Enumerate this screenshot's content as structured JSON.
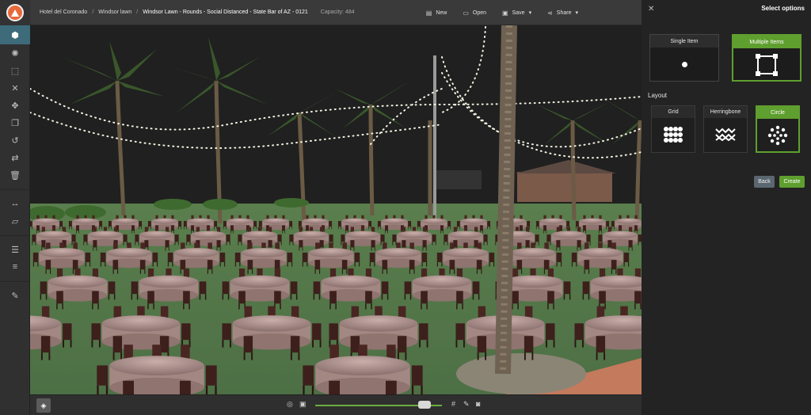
{
  "breadcrumb": {
    "venue": "Hotel del Coronado",
    "space": "Windsor lawn",
    "plan": "Windsor Lawn - Rounds - Social Distanced - State Bar of AZ - 0121",
    "capacity": "Capacity: 484"
  },
  "toolbar": {
    "new_label": "New",
    "open_label": "Open",
    "save_label": "Save",
    "share_label": "Share"
  },
  "panel": {
    "title": "Select options",
    "single_item_label": "Single Item",
    "multiple_items_label": "Multiple Items",
    "layout_heading": "Layout",
    "grid_label": "Grid",
    "herringbone_label": "Herringbone",
    "circle_label": "Circle",
    "back_label": "Back",
    "create_label": "Create"
  },
  "selected_mode": "Multiple Items",
  "selected_layout": "Circle",
  "colors": {
    "accent_green": "#5f9f2f",
    "active_tool": "#3d6b7a",
    "brand_orange": "#e8693b"
  },
  "zoom_level": 0.82
}
